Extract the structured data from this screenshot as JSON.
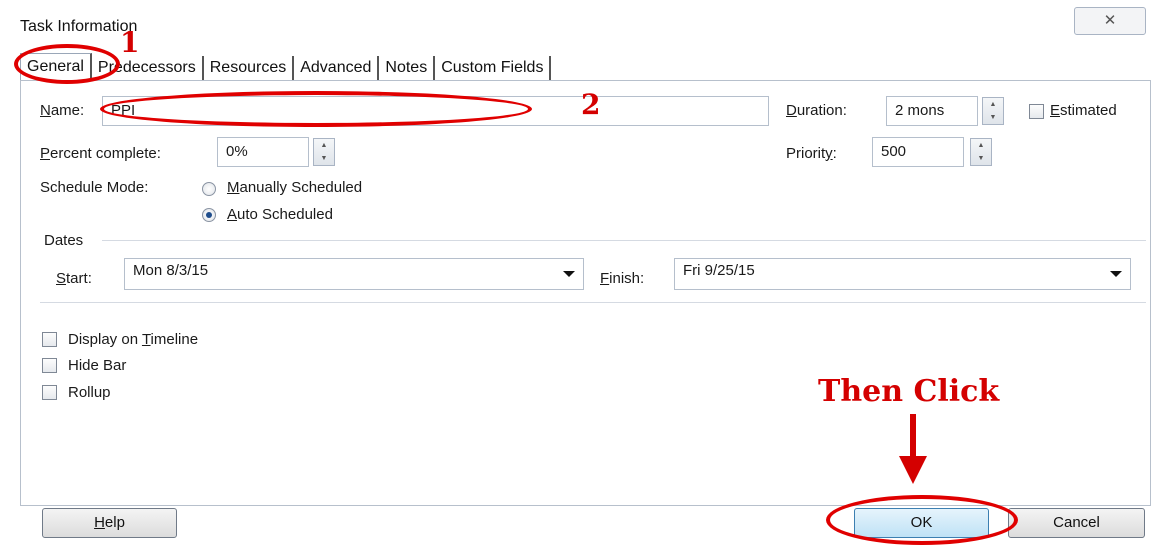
{
  "dialog": {
    "title": "Task Information",
    "close_glyph": "✕"
  },
  "tabs": [
    "General",
    "Predecessors",
    "Resources",
    "Advanced",
    "Notes",
    "Custom Fields"
  ],
  "general": {
    "name_label": "Name:",
    "name_value": "PPI",
    "duration_label": "Duration:",
    "duration_value": "2 mons",
    "estimated_label": "Estimated",
    "estimated_checked": false,
    "percent_label": "Percent complete:",
    "percent_value": "0%",
    "priority_label": "Priority:",
    "priority_value": "500",
    "schedule_mode_label": "Schedule Mode:",
    "schedule_options": [
      "Manually Scheduled",
      "Auto Scheduled"
    ],
    "schedule_selected": "Auto Scheduled",
    "dates_label": "Dates",
    "start_label": "Start:",
    "start_value": "Mon 8/3/15",
    "finish_label": "Finish:",
    "finish_value": "Fri 9/25/15",
    "checkboxes": [
      {
        "label": "Display on Timeline",
        "checked": false
      },
      {
        "label": "Hide Bar",
        "checked": false
      },
      {
        "label": "Rollup",
        "checked": false
      }
    ]
  },
  "buttons": {
    "help": "Help",
    "ok": "OK",
    "cancel": "Cancel"
  },
  "annotations": {
    "step1": "1",
    "step2": "2",
    "then_click": "Then Click",
    "color": "#e00000"
  }
}
